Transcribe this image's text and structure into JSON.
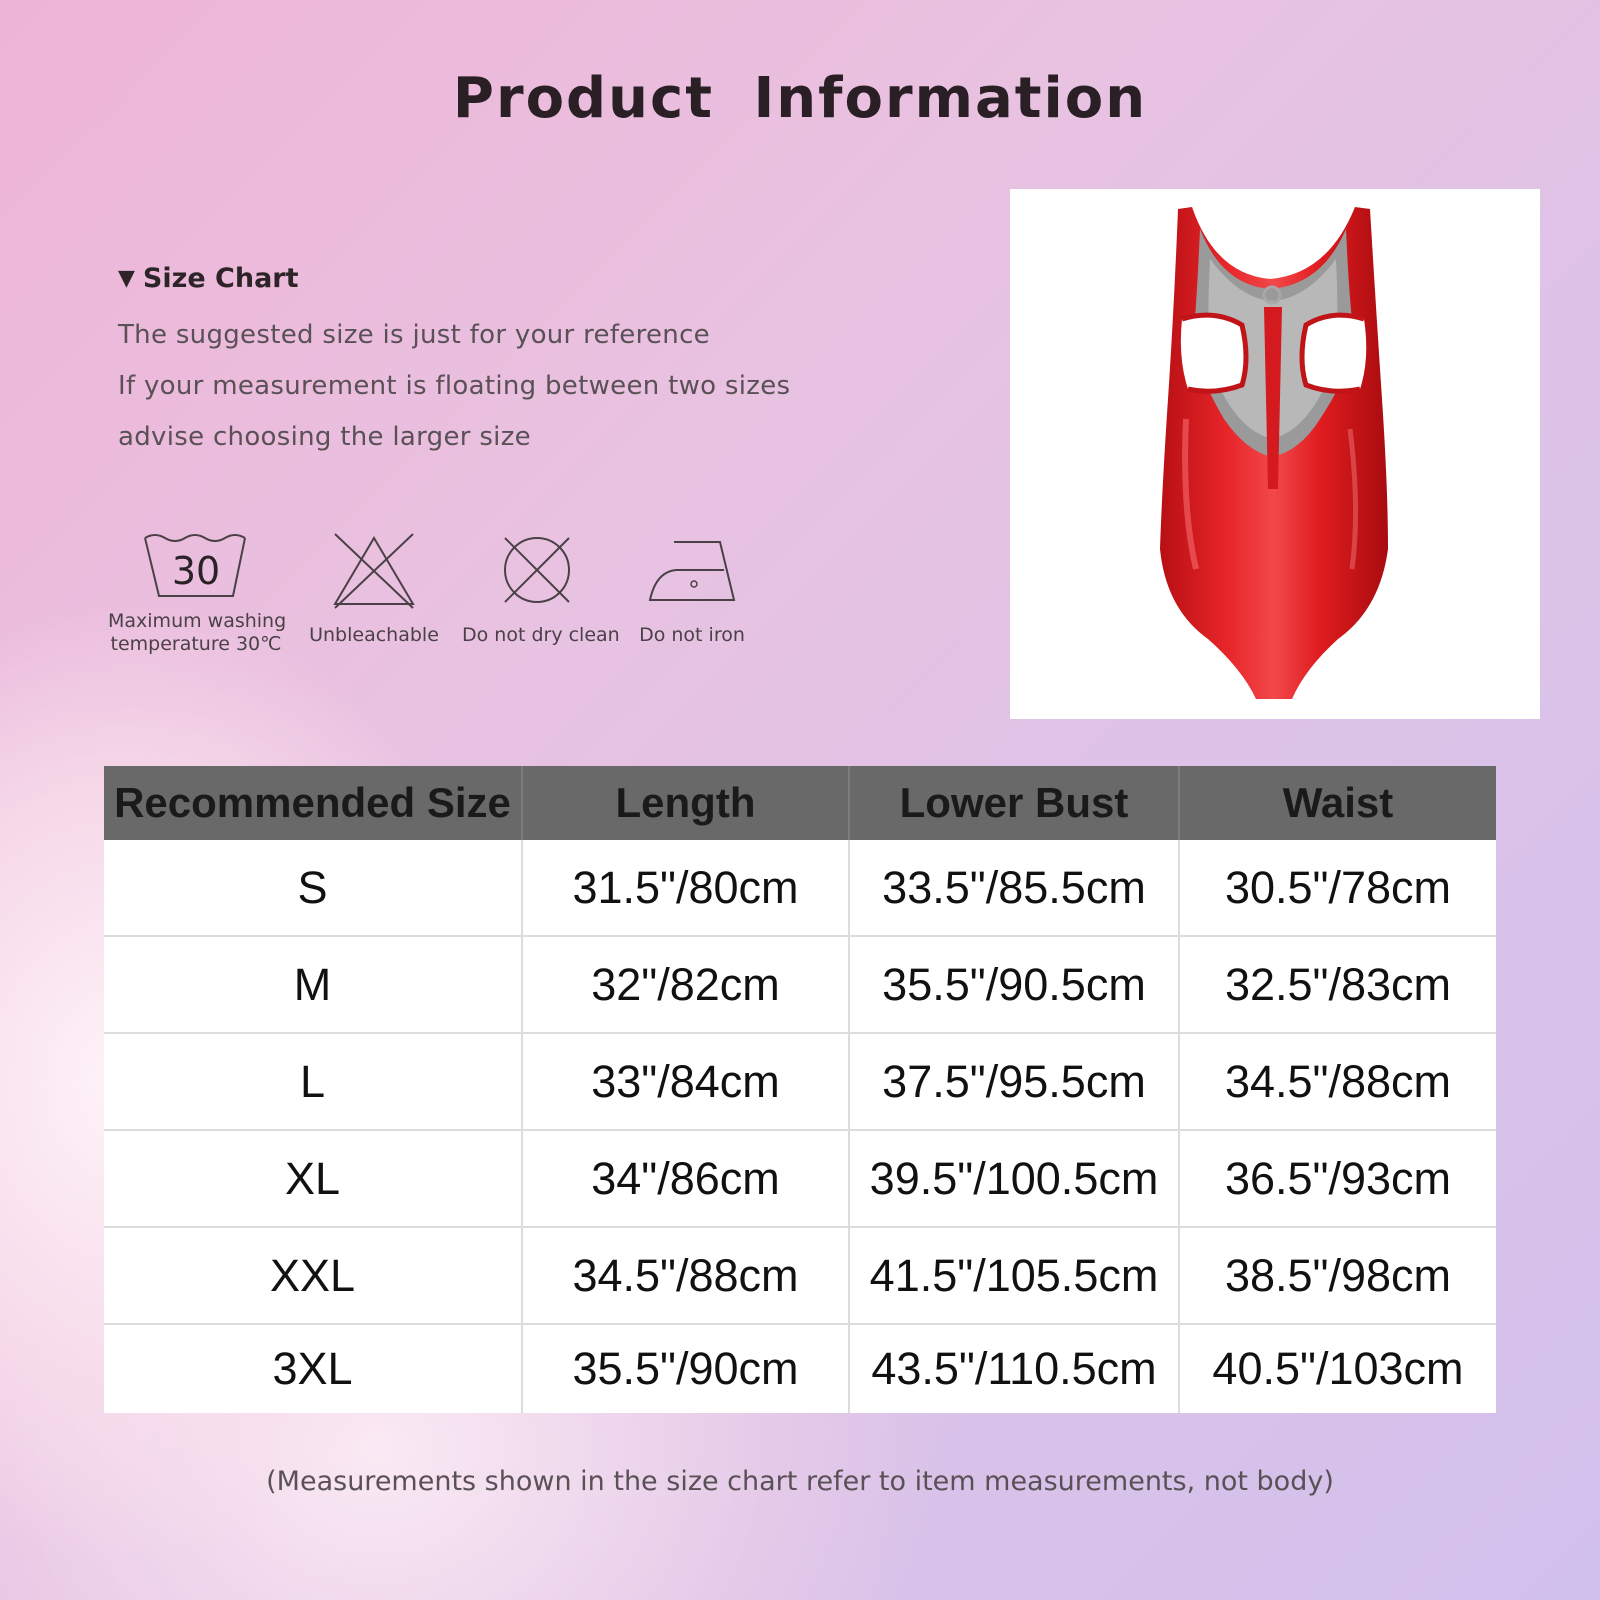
{
  "title": "Product  Information",
  "size_chart": {
    "heading": "Size Chart",
    "notes": [
      "The suggested size is just for your reference",
      "If your measurement is floating between two sizes",
      "advise choosing the larger size"
    ]
  },
  "care_icons": [
    {
      "icon": "wash-30-icon",
      "symbol_text": "30",
      "label_line1": "Maximum washing",
      "label_line2": "temperature 30℃"
    },
    {
      "icon": "no-bleach-icon",
      "label_line1": "Unbleachable"
    },
    {
      "icon": "no-dry-clean-icon",
      "label_line1": "Do not dry clean"
    },
    {
      "icon": "iron-icon",
      "label_line1": "Do not iron"
    }
  ],
  "product_image": {
    "icon": "red-bodysuit-image",
    "color": "#e01c1f"
  },
  "table": {
    "headers": [
      "Recommended Size",
      "Length",
      "Lower Bust",
      "Waist"
    ],
    "rows": [
      [
        "S",
        "31.5\"/80cm",
        "33.5\"/85.5cm",
        "30.5\"/78cm"
      ],
      [
        "M",
        "32\"/82cm",
        "35.5\"/90.5cm",
        "32.5\"/83cm"
      ],
      [
        "L",
        "33\"/84cm",
        "37.5\"/95.5cm",
        "34.5\"/88cm"
      ],
      [
        "XL",
        "34\"/86cm",
        "39.5\"/100.5cm",
        "36.5\"/93cm"
      ],
      [
        "XXL",
        "34.5\"/88cm",
        "41.5\"/105.5cm",
        "38.5\"/98cm"
      ],
      [
        "3XL",
        "35.5\"/90cm",
        "43.5\"/110.5cm",
        "40.5\"/103cm"
      ]
    ]
  },
  "footnote": "(Measurements shown in the size chart refer to item measurements, not body)"
}
